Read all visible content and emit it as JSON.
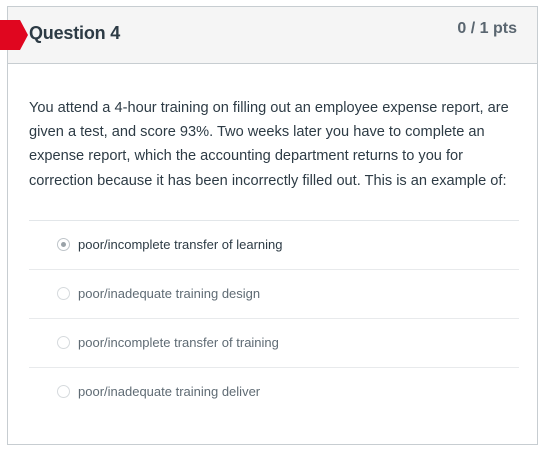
{
  "question": {
    "title": "Question 4",
    "points": "0 / 1 pts",
    "prompt": "You attend a 4-hour training on filling out an employee expense report, are given a test, and score 93%. Two weeks later you have to complete an expense report, which the accounting department returns to you for correction because it has been incorrectly filled out. This is an example of:",
    "flag_color": "#e0061f",
    "answers": [
      {
        "label": "poor/incomplete transfer of learning",
        "selected": true
      },
      {
        "label": "poor/inadequate training design",
        "selected": false
      },
      {
        "label": "poor/incomplete transfer of training",
        "selected": false
      },
      {
        "label": "poor/inadequate training deliver",
        "selected": false
      }
    ]
  }
}
